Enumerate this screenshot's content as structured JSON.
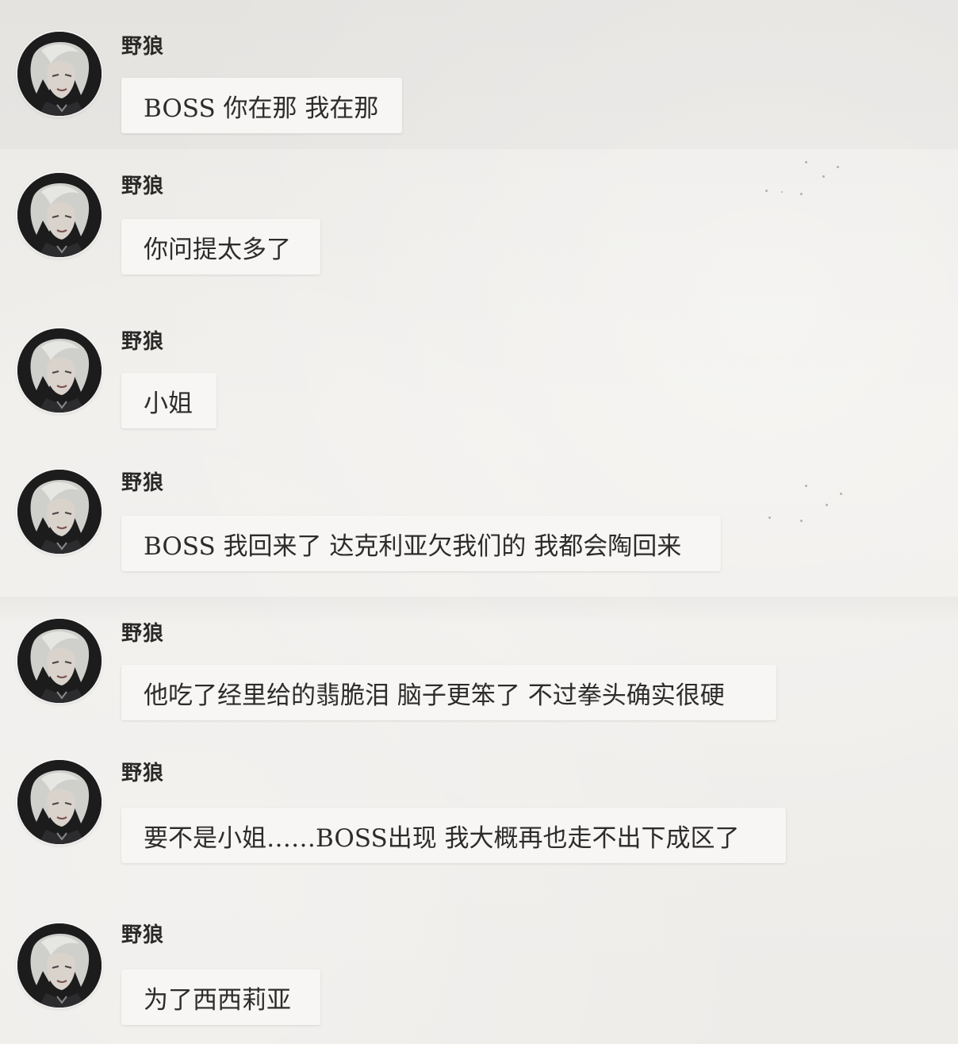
{
  "messages": [
    {
      "sender": "野狼",
      "text": "BOSS 你在那 我在那",
      "avatar_icon": "white-haired-character-avatar"
    },
    {
      "sender": "野狼",
      "text": "你问提太多了",
      "avatar_icon": "white-haired-character-avatar"
    },
    {
      "sender": "野狼",
      "text": "小姐",
      "avatar_icon": "white-haired-character-avatar"
    },
    {
      "sender": "野狼",
      "text": "BOSS 我回来了 达克利亚欠我们的 我都会陶回来",
      "avatar_icon": "white-haired-character-avatar"
    },
    {
      "sender": "野狼",
      "text": "他吃了经里给的翡脆泪 脑子更笨了 不过拳头确实很硬",
      "avatar_icon": "white-haired-character-avatar"
    },
    {
      "sender": "野狼",
      "text": "要不是小姐……BOSS出现 我大概再也走不出下成区了",
      "avatar_icon": "white-haired-character-avatar"
    },
    {
      "sender": "野狼",
      "text": "为了西西莉亚",
      "avatar_icon": "white-haired-character-avatar"
    }
  ],
  "colors": {
    "background": "#efedea",
    "bubble": "#f7f6f4",
    "text": "#2d2c2b",
    "avatar_bg": "#1c1c1d"
  }
}
